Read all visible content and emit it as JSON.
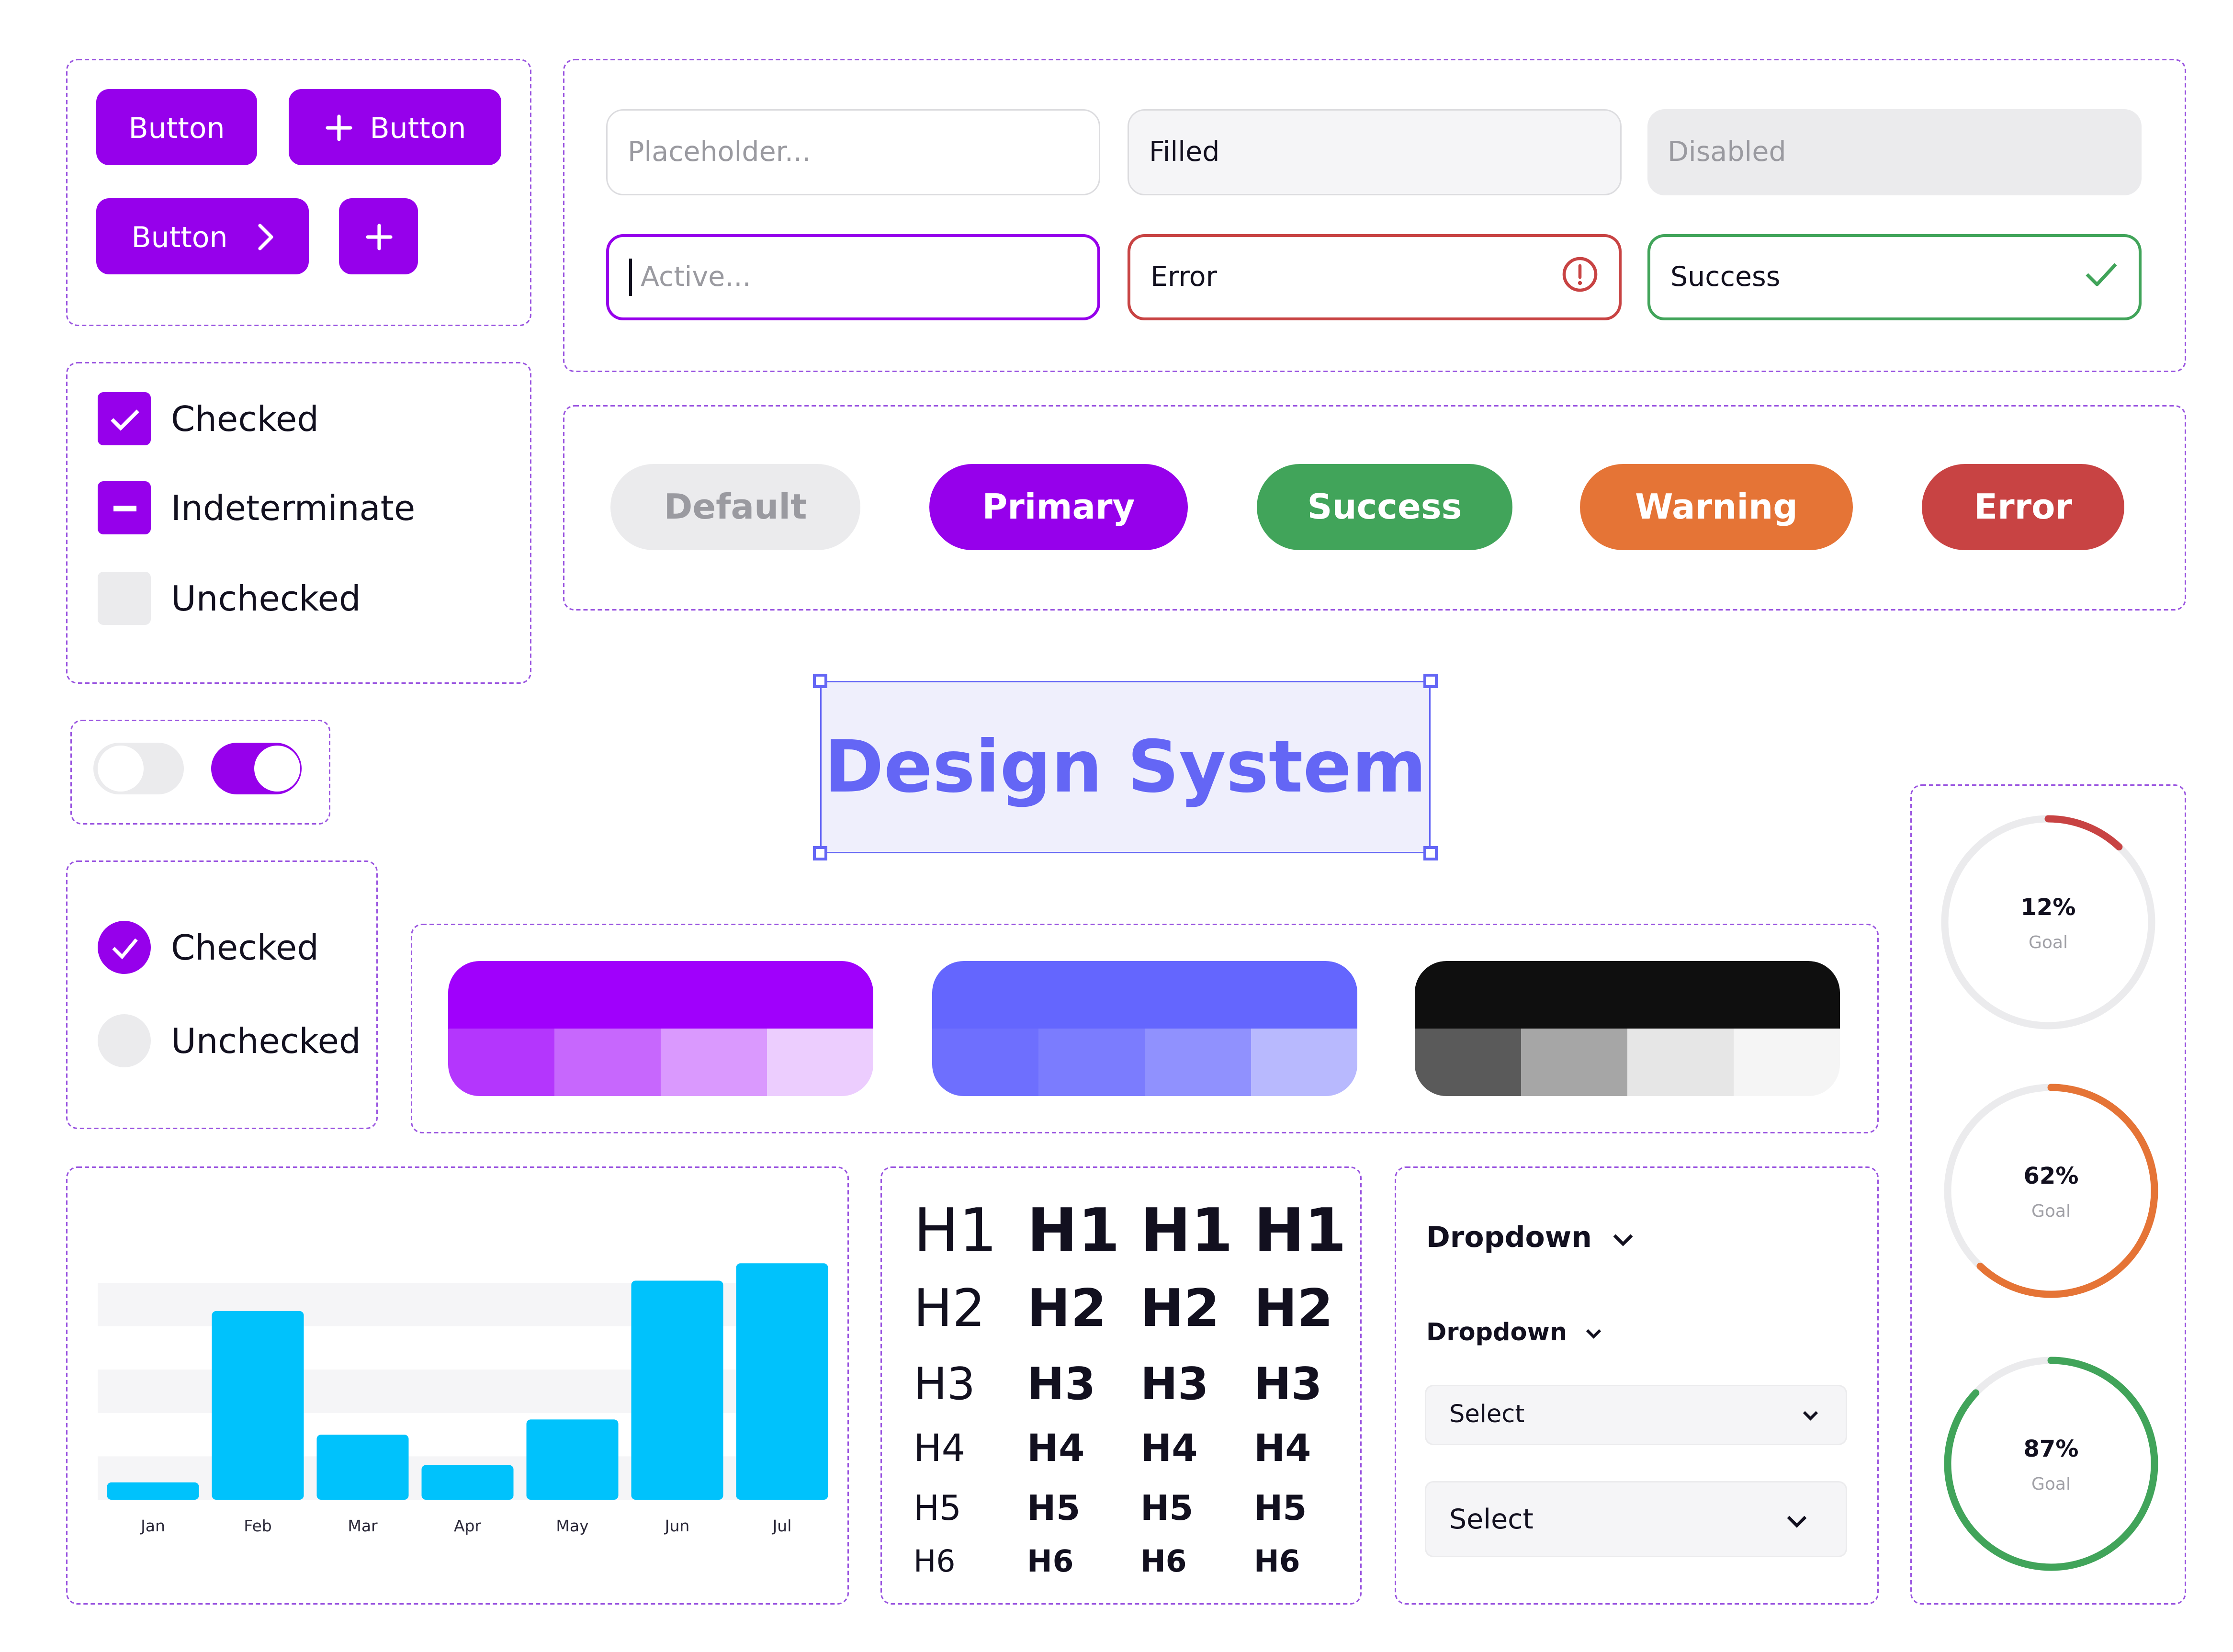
{
  "title": "Design System",
  "colors": {
    "primary": "#9600eb",
    "indigo": "#6466f5",
    "success": "#41a45a",
    "warning": "#e57436",
    "error": "#c84343",
    "default_bg": "#ebebed",
    "default_text": "#9a9aa0",
    "text": "#12101f",
    "chart_bar": "#00c2fc",
    "panel_border": "#9a55e0"
  },
  "buttons": [
    {
      "label": "Button",
      "icon": null
    },
    {
      "label": "Button",
      "icon": "plus-icon",
      "icon_position": "leading"
    },
    {
      "label": "Button",
      "icon": "chevron-right-icon",
      "icon_position": "trailing"
    },
    {
      "label": null,
      "icon": "plus-icon"
    }
  ],
  "inputs": {
    "placeholder": {
      "placeholder": "Placeholder...",
      "value": ""
    },
    "filled": {
      "value": "Filled"
    },
    "disabled": {
      "value": "Disabled",
      "disabled": true
    },
    "active": {
      "placeholder": "Active...",
      "value": "",
      "focused": true
    },
    "error": {
      "value": "Error",
      "icon": "alert-circle-icon"
    },
    "success": {
      "value": "Success",
      "icon": "check-icon"
    }
  },
  "badges": [
    {
      "label": "Default",
      "variant": "default"
    },
    {
      "label": "Primary",
      "variant": "primary"
    },
    {
      "label": "Success",
      "variant": "success"
    },
    {
      "label": "Warning",
      "variant": "warning"
    },
    {
      "label": "Error",
      "variant": "error"
    }
  ],
  "checkboxes": [
    {
      "label": "Checked",
      "state": "checked"
    },
    {
      "label": "Indeterminate",
      "state": "indeterminate"
    },
    {
      "label": "Unchecked",
      "state": "unchecked"
    }
  ],
  "toggles": [
    {
      "name": "toggle-off",
      "on": false
    },
    {
      "name": "toggle-on",
      "on": true
    }
  ],
  "radios": [
    {
      "label": "Checked",
      "checked": true
    },
    {
      "label": "Unchecked",
      "checked": false
    }
  ],
  "palettes": [
    {
      "name": "purple",
      "main": "#a000fc",
      "shades": [
        "#b436fd",
        "#c767fd",
        "#da99fe",
        "#eccdfe"
      ]
    },
    {
      "name": "indigo",
      "main": "#6466fe",
      "shades": [
        "#6e6ffe",
        "#7b7cfe",
        "#9091fe",
        "#b8b9fe"
      ]
    },
    {
      "name": "neutral",
      "main": "#0f0f0f",
      "shades": [
        "#5a5a5a",
        "#a6a6a6",
        "#e6e6e6",
        "#f5f5f5"
      ]
    }
  ],
  "typography": {
    "rows": [
      "H1",
      "H2",
      "H3",
      "H4",
      "H5",
      "H6"
    ],
    "weights": [
      "Regular",
      "Medium",
      "Semibold",
      "Bold"
    ]
  },
  "dropdowns": [
    {
      "label": "Dropdown",
      "size": "large"
    },
    {
      "label": "Dropdown",
      "size": "small"
    }
  ],
  "selects": [
    {
      "value": "Select",
      "size": "small"
    },
    {
      "value": "Select",
      "size": "large"
    }
  ],
  "gauges": [
    {
      "value": 12,
      "label": "12%",
      "sub": "Goal",
      "color": "#c84343"
    },
    {
      "value": 62,
      "label": "62%",
      "sub": "Goal",
      "color": "#e57436"
    },
    {
      "value": 87,
      "label": "87%",
      "sub": "Goal",
      "color": "#41a45a"
    }
  ],
  "chart_data": {
    "type": "bar",
    "title": "",
    "xlabel": "",
    "ylabel": "",
    "categories": [
      "Jan",
      "Feb",
      "Mar",
      "Apr",
      "May",
      "Jun",
      "Jul"
    ],
    "values": [
      8,
      87,
      30,
      16,
      37,
      101,
      109
    ],
    "ylim": [
      0,
      110
    ],
    "grid": "alternating horizontal bands, no tick labels",
    "band_step": 20,
    "bands": 5,
    "legend": "none"
  }
}
